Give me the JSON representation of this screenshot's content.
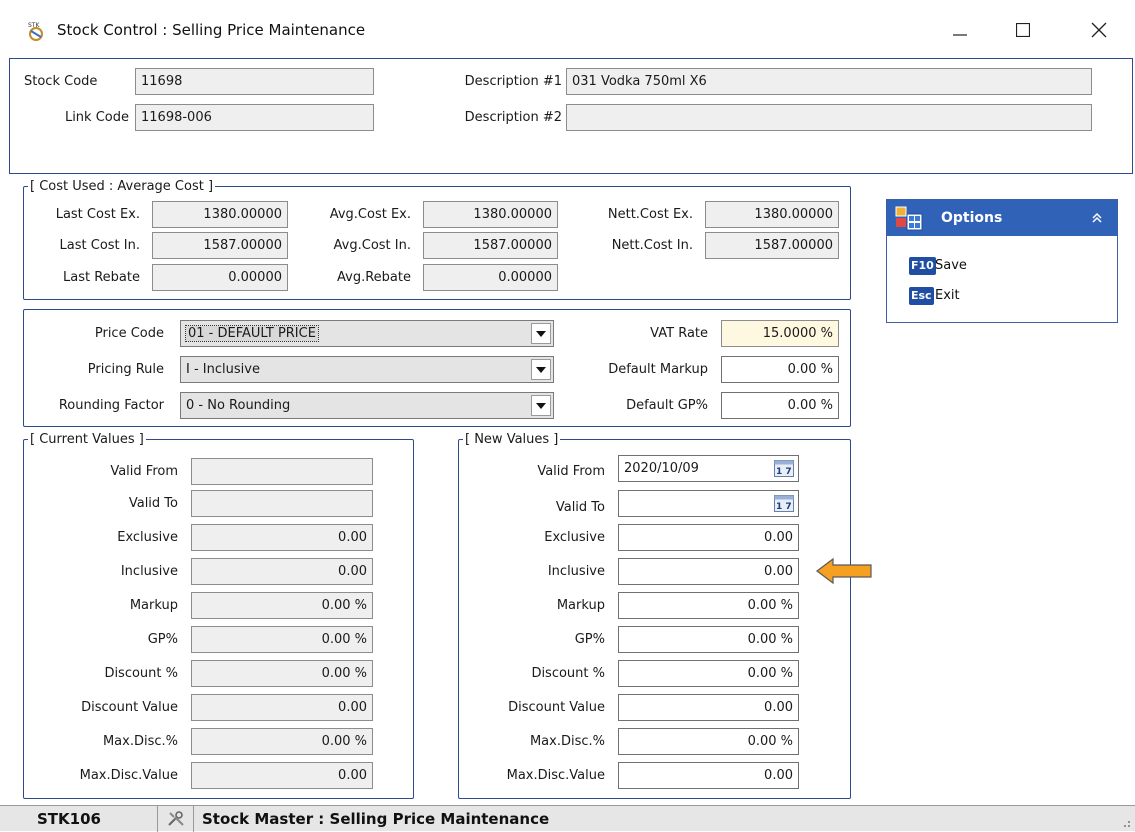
{
  "window": {
    "title": "Stock Control : Selling Price Maintenance",
    "icon_text": "STK"
  },
  "header": {
    "stock_code_label": "Stock Code",
    "stock_code_value": "11698",
    "link_code_label": "Link Code",
    "link_code_value": "11698-006",
    "description1_label": "Description #1",
    "description1_value": "031 Vodka 750ml X6",
    "description2_label": "Description #2",
    "description2_value": ""
  },
  "cost_used": {
    "legend": "[ Cost Used : Average Cost ]",
    "last_cost_ex_label": "Last Cost Ex.",
    "last_cost_ex_value": "1380.00000",
    "avg_cost_ex_label": "Avg.Cost Ex.",
    "avg_cost_ex_value": "1380.00000",
    "nett_cost_ex_label": "Nett.Cost Ex.",
    "nett_cost_ex_value": "1380.00000",
    "last_cost_in_label": "Last Cost In.",
    "last_cost_in_value": "1587.00000",
    "avg_cost_in_label": "Avg.Cost In.",
    "avg_cost_in_value": "1587.00000",
    "nett_cost_in_label": "Nett.Cost In.",
    "nett_cost_in_value": "1587.00000",
    "last_rebate_label": "Last Rebate",
    "last_rebate_value": "0.00000",
    "avg_rebate_label": "Avg.Rebate",
    "avg_rebate_value": "0.00000"
  },
  "pricing": {
    "price_code_label": "Price Code",
    "price_code_value": "01 - DEFAULT PRICE",
    "pricing_rule_label": "Pricing Rule",
    "pricing_rule_value": "I - Inclusive",
    "rounding_factor_label": "Rounding Factor",
    "rounding_factor_value": "0 - No Rounding",
    "vat_rate_label": "VAT Rate",
    "vat_rate_value": "15.0000 %",
    "default_markup_label": "Default Markup",
    "default_markup_value": "0.00 %",
    "default_gp_label": "Default GP%",
    "default_gp_value": "0.00 %"
  },
  "current_values": {
    "legend": "[ Current Values ]",
    "rows": [
      {
        "label": "Valid From",
        "value": ""
      },
      {
        "label": "Valid To",
        "value": ""
      },
      {
        "label": "Exclusive",
        "value": "0.00"
      },
      {
        "label": "Inclusive",
        "value": "0.00"
      },
      {
        "label": "Markup",
        "value": "0.00 %"
      },
      {
        "label": "GP%",
        "value": "0.00 %"
      },
      {
        "label": "Discount %",
        "value": "0.00 %"
      },
      {
        "label": "Discount Value",
        "value": "0.00"
      },
      {
        "label": "Max.Disc.%",
        "value": "0.00 %"
      },
      {
        "label": "Max.Disc.Value",
        "value": "0.00"
      }
    ]
  },
  "new_values": {
    "legend": "[ New Values ]",
    "rows": [
      {
        "label": "Valid From",
        "value": "2020/10/09"
      },
      {
        "label": "Valid To",
        "value": ""
      },
      {
        "label": "Exclusive",
        "value": "0.00"
      },
      {
        "label": "Inclusive",
        "value": "0.00"
      },
      {
        "label": "Markup",
        "value": "0.00 %"
      },
      {
        "label": "GP%",
        "value": "0.00 %"
      },
      {
        "label": "Discount %",
        "value": "0.00 %"
      },
      {
        "label": "Discount Value",
        "value": "0.00"
      },
      {
        "label": "Max.Disc.%",
        "value": "0.00 %"
      },
      {
        "label": "Max.Disc.Value",
        "value": "0.00"
      }
    ]
  },
  "options": {
    "title": "Options",
    "items": [
      {
        "key": "F10",
        "label": "Save"
      },
      {
        "key": "Esc",
        "label": "Exit"
      }
    ]
  },
  "statusbar": {
    "code": "STK106",
    "title": "Stock Master : Selling Price Maintenance"
  },
  "colors": {
    "accent": "#3062b8",
    "border": "#2d4a8a",
    "arrow": "#f5a020"
  }
}
